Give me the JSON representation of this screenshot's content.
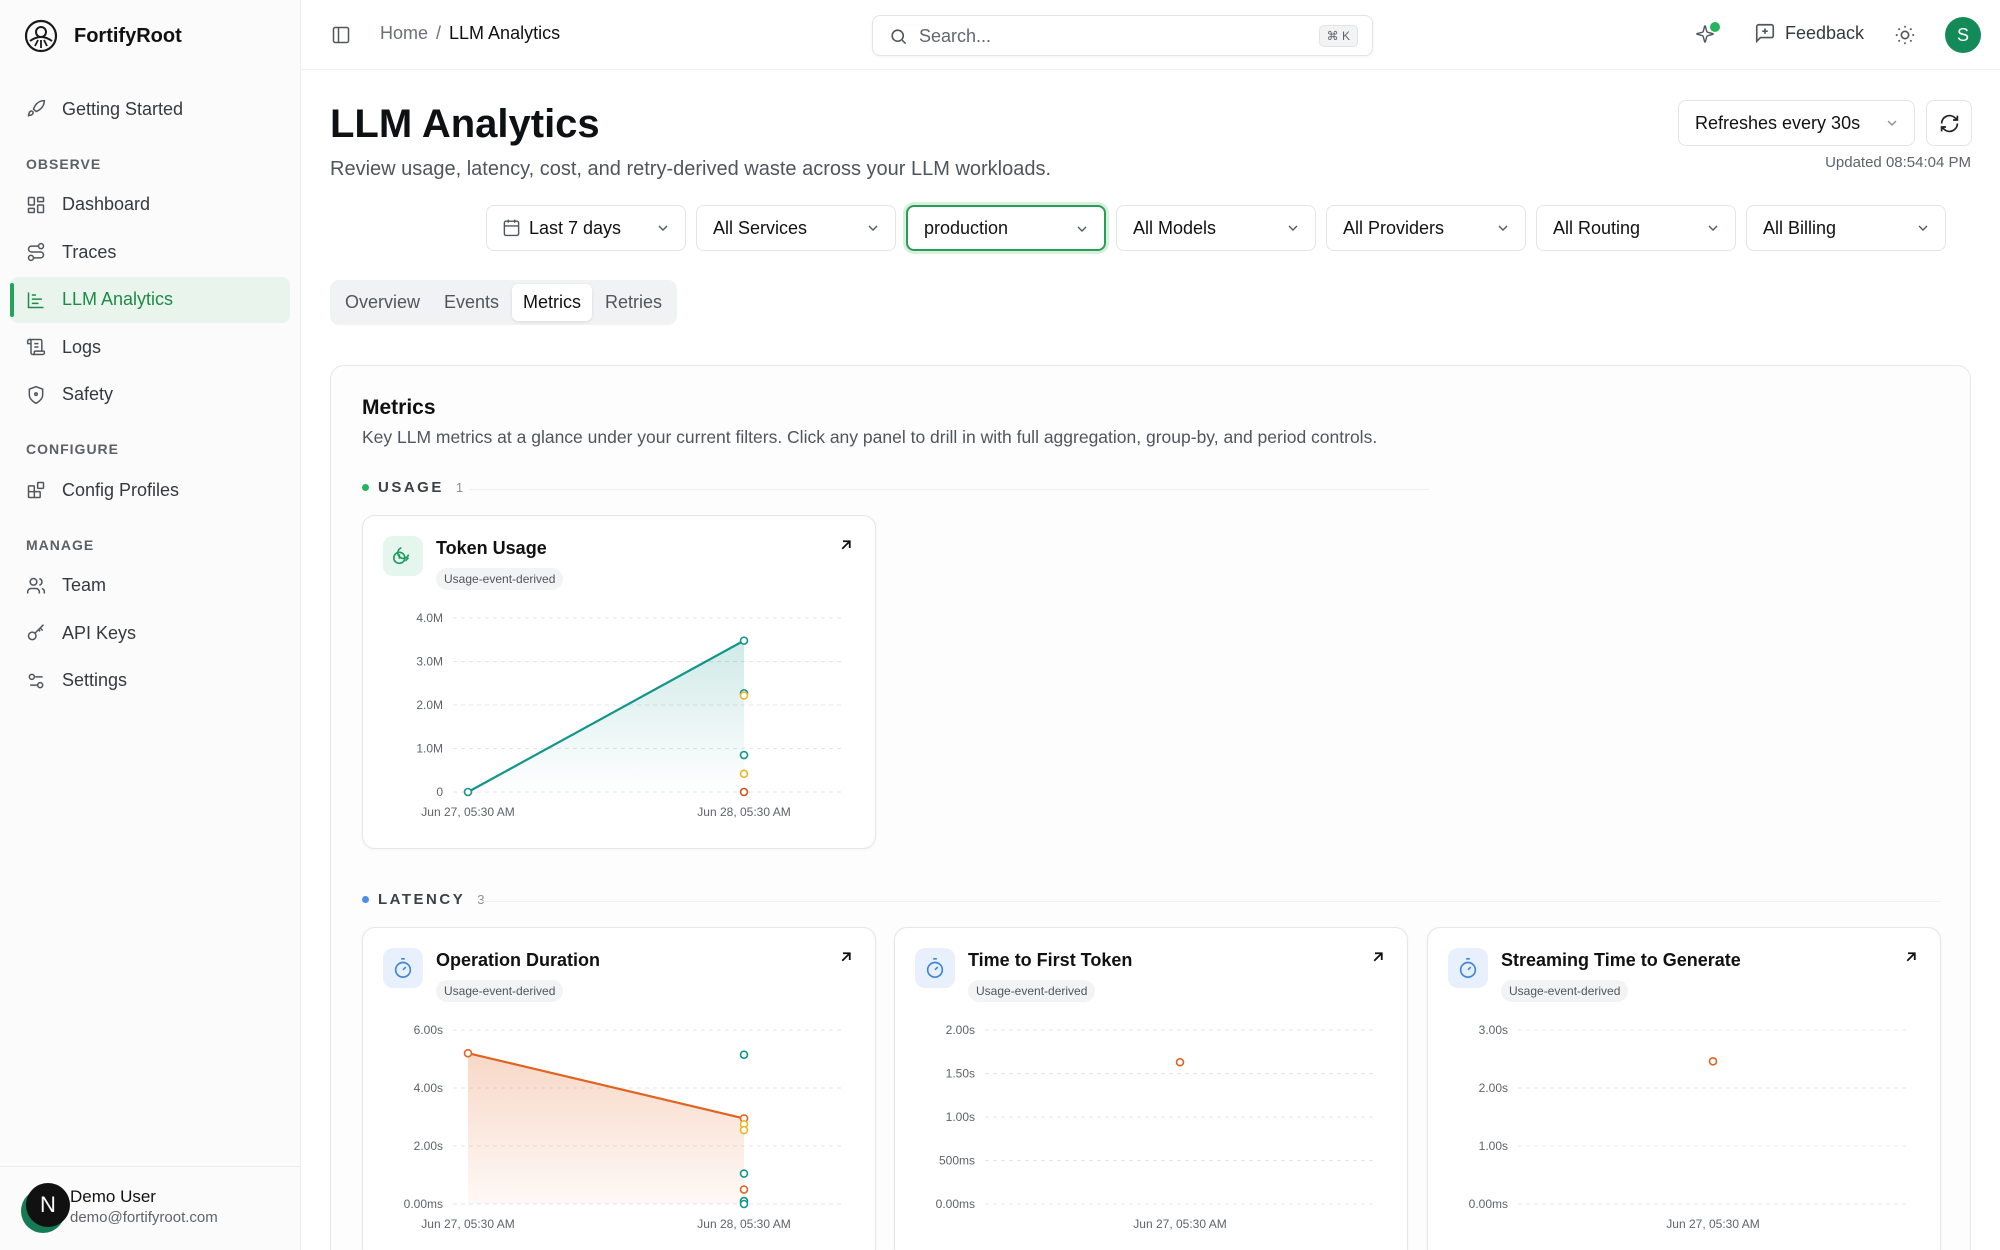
{
  "app": {
    "name": "FortifyRoot"
  },
  "sidebar": {
    "getting_started": "Getting Started",
    "sections": {
      "observe": "OBSERVE",
      "configure": "CONFIGURE",
      "manage": "MANAGE"
    },
    "items": {
      "dashboard": "Dashboard",
      "traces": "Traces",
      "llm_analytics": "LLM Analytics",
      "logs": "Logs",
      "safety": "Safety",
      "config_profiles": "Config Profiles",
      "team": "Team",
      "api_keys": "API Keys",
      "settings": "Settings"
    },
    "user": {
      "initial": "N",
      "name": "Demo User",
      "email": "demo@fortifyroot.com"
    }
  },
  "topbar": {
    "breadcrumb": {
      "home": "Home",
      "separator": "/",
      "current": "LLM Analytics"
    },
    "search": {
      "placeholder": "Search...",
      "shortcut": "⌘ K"
    },
    "feedback_label": "Feedback",
    "avatar_initial": "S"
  },
  "page": {
    "title": "LLM Analytics",
    "subtitle": "Review usage, latency, cost, and retry-derived waste across your LLM workloads.",
    "refresh_label": "Refreshes every 30s",
    "updated": "Updated 08:54:04 PM"
  },
  "filters": {
    "date": "Last 7 days",
    "services": "All Services",
    "environment": "production",
    "models": "All Models",
    "providers": "All Providers",
    "routing": "All Routing",
    "billing": "All Billing"
  },
  "tabs": {
    "overview": "Overview",
    "events": "Events",
    "metrics": "Metrics",
    "retries": "Retries"
  },
  "metrics": {
    "title": "Metrics",
    "description": "Key LLM metrics at a glance under your current filters. Click any panel to drill in with full aggregation, group-by, and period controls.",
    "sections": {
      "usage": {
        "label": "USAGE",
        "count": "1"
      },
      "latency": {
        "label": "LATENCY",
        "count": "3"
      }
    },
    "panels": {
      "token_usage": {
        "title": "Token Usage",
        "badge": "Usage-event-derived"
      },
      "operation_duration": {
        "title": "Operation Duration",
        "badge": "Usage-event-derived"
      },
      "ttft": {
        "title": "Time to First Token",
        "badge": "Usage-event-derived"
      },
      "streaming": {
        "title": "Streaming Time to Generate",
        "badge": "Usage-event-derived"
      }
    }
  },
  "colors": {
    "accent_green": "#22a55a",
    "teal": "#12958a",
    "orange": "#e2631f",
    "yellow": "#e8b829",
    "brown": "#c9541b",
    "blue_dot": "#4a90e2"
  },
  "chart_data": [
    {
      "type": "area",
      "title": "Token Usage",
      "y_ticks": [
        "4.0M",
        "3.0M",
        "2.0M",
        "1.0M",
        "0"
      ],
      "x_ticks": [
        "Jun 27, 05:30 AM",
        "Jun 28, 05:30 AM"
      ],
      "ylim": [
        0,
        4000000
      ],
      "x": [
        "Jun 27, 05:30 AM",
        "Jun 28, 05:30 AM"
      ],
      "series": [
        {
          "values": [
            0,
            3480000
          ]
        }
      ],
      "extra_points": [
        {
          "value": 2270000,
          "color": "#12958a"
        },
        {
          "value": 2220000,
          "color": "#e8b829"
        },
        {
          "value": 850000,
          "color": "#12958a"
        },
        {
          "value": 420000,
          "color": "#e8b829"
        },
        {
          "value": 0,
          "color": "#c9541b"
        }
      ]
    },
    {
      "type": "area",
      "title": "Operation Duration",
      "y_ticks": [
        "6.00s",
        "4.00s",
        "2.00s",
        "0.00ms"
      ],
      "x_ticks": [
        "Jun 27, 05:30 AM",
        "Jun 28, 05:30 AM"
      ],
      "ylim": [
        0,
        6
      ],
      "x": [
        "Jun 27, 05:30 AM",
        "Jun 28, 05:30 AM"
      ],
      "series": [
        {
          "values": [
            5.2,
            2.95
          ]
        }
      ],
      "extra_points": [
        {
          "value": 5.15,
          "color": "#12958a"
        },
        {
          "value": 2.75,
          "color": "#e8b829"
        },
        {
          "value": 2.55,
          "color": "#e8b829"
        },
        {
          "value": 1.05,
          "color": "#12958a"
        },
        {
          "value": 0.5,
          "color": "#e2631f"
        },
        {
          "value": 0.1,
          "color": "#12958a"
        },
        {
          "value": 0.0,
          "color": "#12958a"
        }
      ]
    },
    {
      "type": "scatter",
      "title": "Time to First Token",
      "y_ticks": [
        "2.00s",
        "1.50s",
        "1.00s",
        "500ms",
        "0.00ms"
      ],
      "x_ticks": [
        "Jun 27, 05:30 AM"
      ],
      "ylim": [
        0,
        2
      ],
      "x": [
        "Jun 27, 05:30 AM"
      ],
      "series": [
        {
          "values": [
            1.63
          ]
        }
      ]
    },
    {
      "type": "scatter",
      "title": "Streaming Time to Generate",
      "y_ticks": [
        "3.00s",
        "2.00s",
        "1.00s",
        "0.00ms"
      ],
      "x_ticks": [
        "Jun 27, 05:30 AM"
      ],
      "ylim": [
        0,
        3
      ],
      "x": [
        "Jun 27, 05:30 AM"
      ],
      "series": [
        {
          "values": [
            2.46
          ]
        }
      ]
    }
  ]
}
